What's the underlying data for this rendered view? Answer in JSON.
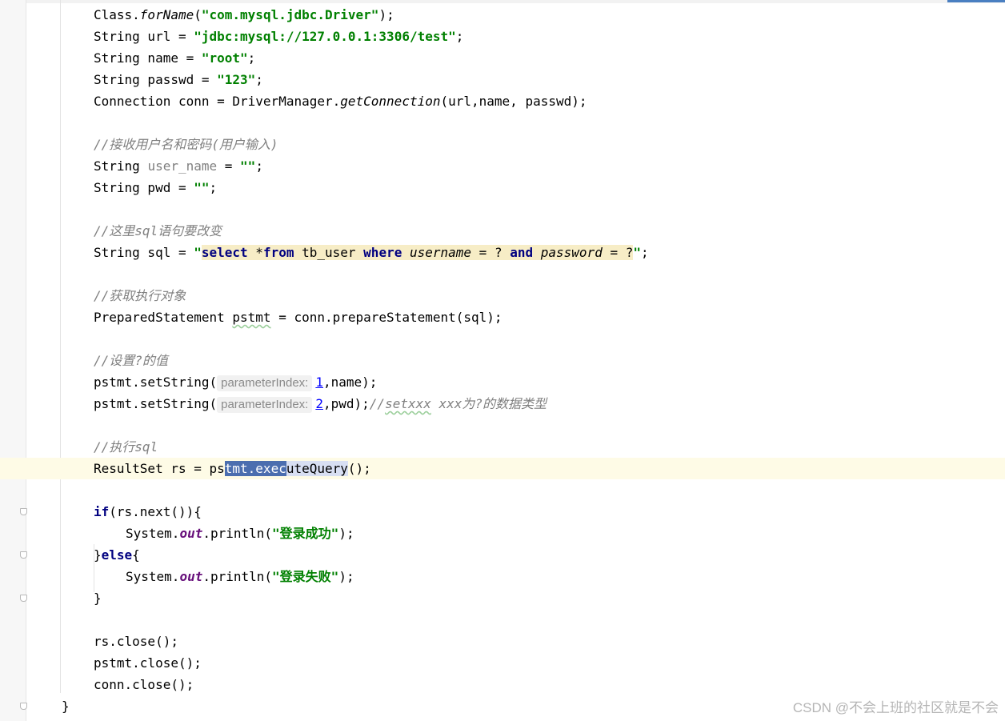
{
  "code": {
    "l1": {
      "a": "Class.",
      "b": "forName",
      "c": "(",
      "d": "\"com.mysql.jdbc.Driver\"",
      "e": ");"
    },
    "l2": {
      "a": "String url = ",
      "b": "\"jdbc:mysql://127.0.0.1:3306/test\"",
      "c": ";"
    },
    "l3": {
      "a": "String name = ",
      "b": "\"root\"",
      "c": ";"
    },
    "l4": {
      "a": "String passwd = ",
      "b": "\"123\"",
      "c": ";"
    },
    "l5": {
      "a": "Connection conn = DriverManager.",
      "b": "getConnection",
      "c": "(url,name, passwd);"
    },
    "l7": {
      "a": "//接收用户名和密码(用户输入)"
    },
    "l8": {
      "a": "String ",
      "b": "user_name",
      "c": " = ",
      "d": "\"\"",
      "e": ";"
    },
    "l9": {
      "a": "String pwd = ",
      "b": "\"\"",
      "c": ";"
    },
    "l11": {
      "a": "//这里sql语句要改变"
    },
    "l12": {
      "a": "String sql = ",
      "q1": "\"",
      "k1": "select",
      "t1": " *",
      "k2": "from",
      "t2": " tb_user ",
      "k3": "where",
      "t3": " ",
      "i1": "username",
      "t4": " = ? ",
      "k4": "and",
      "t5": " ",
      "i2": "password",
      "t6": " = ?",
      "q2": "\"",
      "e": ";"
    },
    "l14": {
      "a": "//获取执行对象"
    },
    "l15": {
      "a": "PreparedStatement ",
      "b": "pstmt",
      "c": " = conn.prepareStatement(sql);"
    },
    "l17": {
      "a": "//设置?的值"
    },
    "l18": {
      "a": "pstmt.setString(",
      "hint": "parameterIndex:",
      "n": "1",
      "c": ",name);"
    },
    "l19": {
      "a": "pstmt.setString(",
      "hint": "parameterIndex:",
      "n": "2",
      "c": ",pwd);",
      "cmt1": "//",
      "cmt2": "setxxx",
      "cmt3": " xxx为?的数据类型"
    },
    "l21": {
      "a": "//执行sql"
    },
    "l22": {
      "a": "ResultSet rs = ps",
      "s": "tmt.exec",
      "t": "uteQuery",
      "e": "();"
    },
    "l24": {
      "k": "if",
      "a": "(rs.next()){"
    },
    "l25": {
      "a": "System.",
      "f": "out",
      "b": ".println(",
      "s": "\"登录成功\"",
      "c": ");"
    },
    "l26": {
      "a": "}",
      "k": "else",
      "b": "{"
    },
    "l27": {
      "a": "System.",
      "f": "out",
      "b": ".println(",
      "s": "\"登录失败\"",
      "c": ");"
    },
    "l28": {
      "a": "}"
    },
    "l30": {
      "a": "rs.close();"
    },
    "l31": {
      "a": "pstmt.close();"
    },
    "l32": {
      "a": "conn.close();"
    },
    "l33": {
      "a": "}"
    }
  },
  "watermark": "CSDN @不会上班的社区就是不会",
  "colors": {
    "keyword": "#000080",
    "string": "#008000",
    "comment": "#808080",
    "field": "#660e7a",
    "selection": "#4b6eaf",
    "current_line": "#fefbe6"
  }
}
